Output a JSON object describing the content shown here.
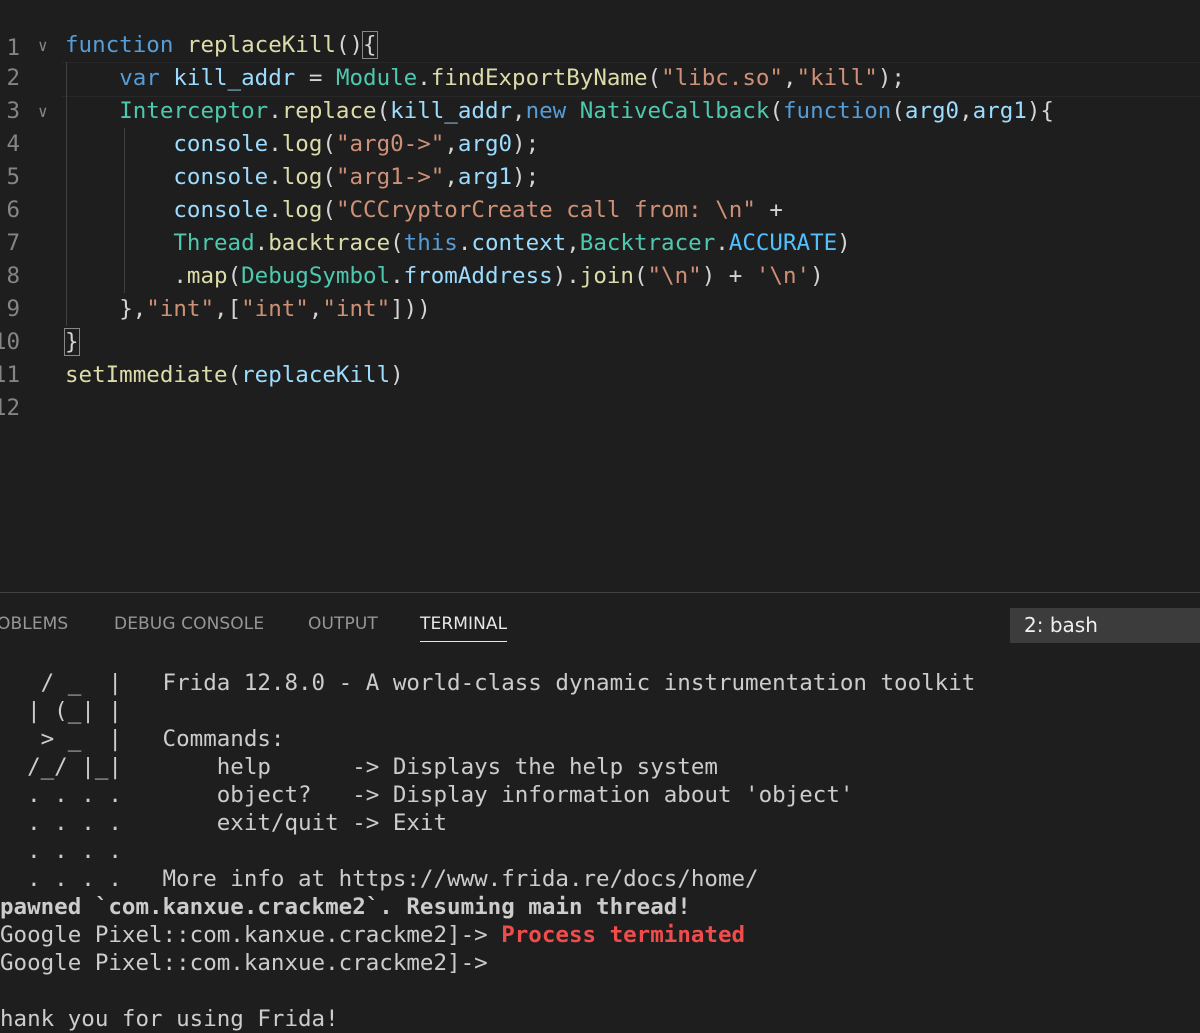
{
  "editor": {
    "line_numbers": [
      "1",
      "2",
      "3",
      "4",
      "5",
      "6",
      "7",
      "8",
      "9",
      "10",
      "11",
      "12"
    ],
    "fold_marker": "∨",
    "code": {
      "l2": {
        "kw_function": "function",
        "name": "replaceKill",
        "parens": "()",
        "brace": "{"
      },
      "l3": {
        "var": "var",
        "name": "kill_addr",
        "eq": " = ",
        "module": "Module",
        "dot": ".",
        "method": "findExportByName",
        "open": "(",
        "s1": "\"libc.so\"",
        "comma": ",",
        "s2": "\"kill\"",
        "close": ");"
      },
      "l4": {
        "interceptor": "Interceptor",
        "dot": ".",
        "method": "replace",
        "open": "(",
        "arg": "kill_addr",
        "comma": ",",
        "new": "new",
        "space": " ",
        "native": "NativeCallback",
        "open2": "(",
        "function": "function",
        "open3": "(",
        "p0": "arg0",
        "comma2": ",",
        "p1": "arg1",
        "close": "){"
      },
      "l5": {
        "console": "console",
        "dot": ".",
        "method": "log",
        "open": "(",
        "str": "\"arg0->\"",
        "comma": ",",
        "arg": "arg0",
        "close": ");"
      },
      "l6": {
        "console": "console",
        "dot": ".",
        "method": "log",
        "open": "(",
        "str": "\"arg1->\"",
        "comma": ",",
        "arg": "arg1",
        "close": ");"
      },
      "l7": {
        "console": "console",
        "dot": ".",
        "method": "log",
        "open": "(",
        "str": "\"CCCryptorCreate call from: \\n\"",
        "plus": " +"
      },
      "l8": {
        "thread": "Thread",
        "dot": ".",
        "method": "backtrace",
        "open": "(",
        "this": "this",
        "dot2": ".",
        "context": "context",
        "comma": ",",
        "bt": "Backtracer",
        "dot3": ".",
        "acc": "ACCURATE",
        "close": ")"
      },
      "l9": {
        "dot": ".",
        "map": "map",
        "open": "(",
        "ds": "DebugSymbol",
        "dot2": ".",
        "from": "fromAddress",
        "close": ")",
        "dot3": ".",
        "join": "join",
        "open2": "(",
        "nl": "\"\\n\"",
        "close2": ")",
        "plus": " + ",
        "nl2": "'\\n'",
        "close3": ")"
      },
      "l10": {
        "start": "},",
        "s1": "\"int\"",
        "comma": ",",
        "open": "[",
        "s2": "\"int\"",
        "comma2": ",",
        "s3": "\"int\"",
        "close": "]))"
      },
      "l11": {
        "brace": "}"
      },
      "l12": {
        "fn": "setImmediate",
        "open": "(",
        "arg": "replaceKill",
        "close": ")"
      }
    }
  },
  "panel": {
    "tabs": [
      "OBLEMS",
      "DEBUG CONSOLE",
      "OUTPUT",
      "TERMINAL"
    ],
    "terminal_select": "2: bash"
  },
  "terminal": {
    "lines": [
      "   / _  |   Frida 12.8.0 - A world-class dynamic instrumentation toolkit",
      "  | (_| |",
      "   > _  |   Commands:",
      "  /_/ |_|       help      -> Displays the help system",
      "  . . . .       object?   -> Display information about 'object'",
      "  . . . .       exit/quit -> Exit",
      "  . . . .",
      "  . . . .   More info at https://www.frida.re/docs/home/",
      "pawned `com.kanxue.crackme2`. Resuming main thread!",
      "Google Pixel::com.kanxue.crackme2]-> ",
      "Google Pixel::com.kanxue.crackme2]->",
      "",
      "hank you for using Frida!"
    ],
    "process_terminated": "Process terminated",
    "colors": {
      "error": "#f14c4c"
    }
  },
  "colors": {
    "keyword": "#569cd6",
    "function": "#dcdcaa",
    "string": "#ce9178",
    "variable": "#9cdcfe",
    "class": "#4ec9b0"
  }
}
